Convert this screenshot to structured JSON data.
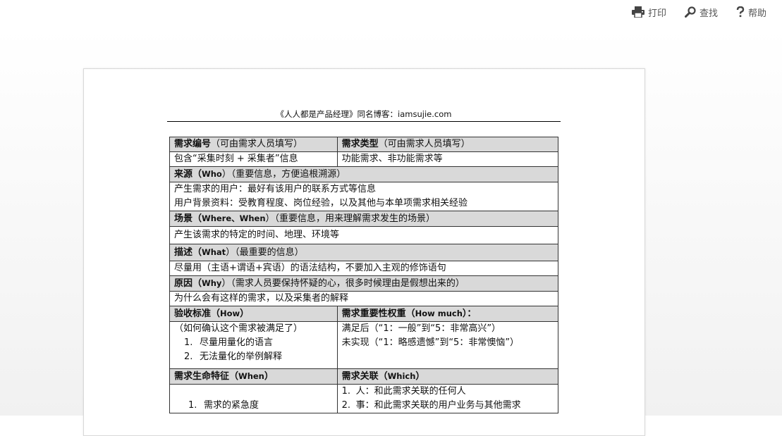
{
  "toolbar": {
    "print_label": "打印",
    "find_label": "查找",
    "help_label": "帮助",
    "icons": [
      "printer-icon",
      "search-icon",
      "help-icon"
    ]
  },
  "document": {
    "header": "《人人都是产品经理》同名博客：iamsujie.com",
    "rows": {
      "id_title": "需求编号",
      "id_note": "（可由需求人员填写）",
      "type_title": "需求类型",
      "type_note": "（可由需求人员填写）",
      "id_value": "包含“采集时刻 + 采集者”信息",
      "type_value": "功能需求、非功能需求等",
      "source_title": "来源（",
      "source_en": "Who",
      "source_note": "）（重要信息，方便追根溯源）",
      "source_line1": "产生需求的用户：最好有该用户的联系方式等信息",
      "source_line2": "用户背景资料：受教育程度、岗位经验，以及其他与本单项需求相关经验",
      "scene_title": "场景（",
      "scene_en": "Where、When",
      "scene_note": "）（重要信息，用来理解需求发生的场景）",
      "scene_value": "产生该需求的特定的时间、地理、环境等",
      "desc_title": "描述（",
      "desc_en": "What",
      "desc_note": "）（最重要的信息）",
      "desc_value": "尽量用（主语+谓语+宾语）的语法结构，不要加入主观的修饰语句",
      "reason_title": "原因（",
      "reason_en": "Why",
      "reason_note": "）（需求人员要保持怀疑的心，很多时候理由是假想出来的）",
      "reason_value": "为什么会有这样的需求，以及采集者的解释",
      "accept_title": "验收标准（",
      "accept_en": "How",
      "accept_close": "）",
      "weight_title": "需求重要性权重（",
      "weight_en": "How much",
      "weight_close": "）：",
      "accept_line0": "（如何确认这个需求被满足了）",
      "accept_item1_num": "1.",
      "accept_item1": "尽量用量化的语言",
      "accept_item2_num": "2.",
      "accept_item2": "无法量化的举例解释",
      "weight_line1": "满足后（“1：一般”到“5：非常高兴”）",
      "weight_line2": "未实现（“1：略感遗憾”到“5：非常懊恼”）",
      "life_title": "需求生命特征（",
      "life_en": "When",
      "life_close": "）",
      "rel_title": "需求关联（",
      "rel_en": "Which",
      "rel_close": "）",
      "life_item1_num": "1.",
      "life_item1": "需求的紧急度",
      "rel_item1_num": "1.",
      "rel_item1": "人：和此需求关联的任何人",
      "rel_item2_num": "2.",
      "rel_item2": "事：和此需求关联的用户业务与其他需求"
    }
  }
}
